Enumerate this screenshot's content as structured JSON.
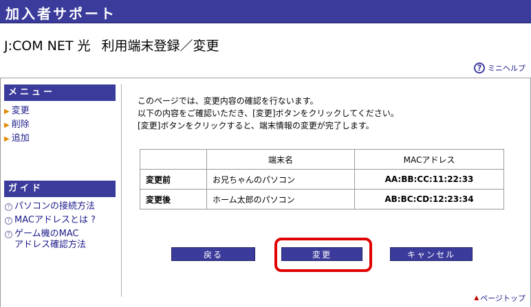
{
  "header": {
    "title": "加入者サポート"
  },
  "page": {
    "title_a": "J:COM NET 光",
    "title_b": "利用端末登録／変更"
  },
  "minihelp": {
    "label": "ミニヘルプ",
    "icon": "question-icon"
  },
  "sidebar": {
    "menu_title": "メニュー",
    "menu_items": [
      {
        "label": "変更"
      },
      {
        "label": "削除"
      },
      {
        "label": "追加"
      }
    ],
    "guide_title": "ガイド",
    "guide_items": [
      {
        "label": "パソコンの接続方法"
      },
      {
        "label": "MACアドレスとは ?"
      },
      {
        "label_line1": "ゲーム機のMAC",
        "label_line2": "アドレス確認方法"
      }
    ]
  },
  "main": {
    "intro_lines": [
      "このページでは、変更内容の確認を行ないます。",
      "以下の内容をご確認いただき、[変更]ボタンをクリックしてください。",
      "[変更]ボタンをクリックすると、端末情報の変更が完了します。"
    ],
    "table": {
      "headers": [
        "",
        "端末名",
        "MACアドレス"
      ],
      "rows": [
        {
          "label": "変更前",
          "name": "お兄ちゃんのパソコン",
          "mac": "AA:BB:CC:11:22:33"
        },
        {
          "label": "変更後",
          "name": "ホーム太郎のパソコン",
          "mac": "AB:BC:CD:12:23:34"
        }
      ]
    },
    "buttons": {
      "back": "戻る",
      "change": "変更",
      "cancel": "キャンセル"
    }
  },
  "footer": {
    "page_top": "ページトップ"
  },
  "colors": {
    "brand": "#3b3b9c",
    "highlight": "#e00000",
    "link": "#1a1a8a"
  }
}
